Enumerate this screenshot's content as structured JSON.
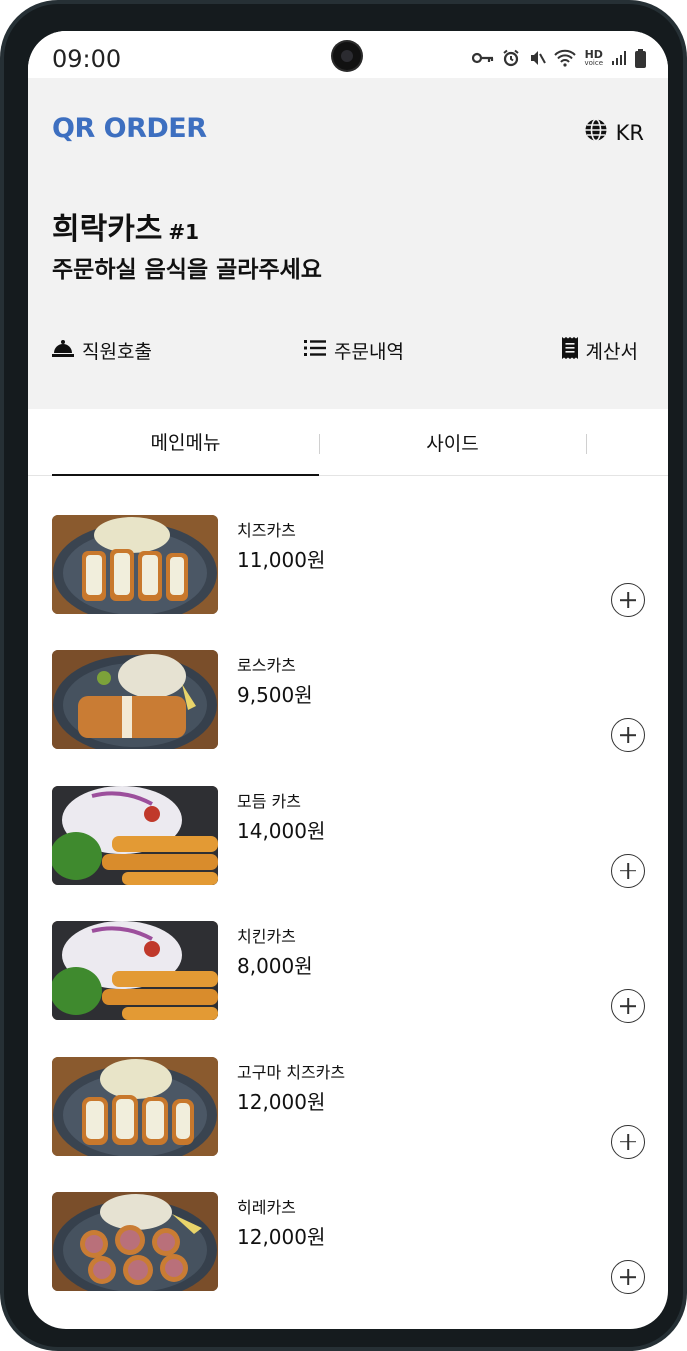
{
  "status_bar": {
    "time": "09:00",
    "icons": [
      "vpn-key-icon",
      "alarm-icon",
      "mute-icon",
      "wifi-icon",
      "hd-voice-icon",
      "signal-icon",
      "battery-icon"
    ],
    "hd_label": "HD",
    "voice_label": "voice"
  },
  "header": {
    "logo": "QR ORDER",
    "language": "KR",
    "restaurant_name": "희락카츠",
    "table_number": "#1",
    "subtitle": "주문하실 음식을 골라주세요",
    "brand_color": "#3d6fc0",
    "background_color": "#f2f2f2"
  },
  "actions": {
    "call_staff": "직원호출",
    "order_history": "주문내역",
    "bill": "계산서"
  },
  "tabs": [
    {
      "label": "메인메뉴",
      "active": true
    },
    {
      "label": "사이드",
      "active": false
    }
  ],
  "menu_items": [
    {
      "name": "치즈카츠",
      "price": "11,000원",
      "image": "cheese-katsu"
    },
    {
      "name": "로스카츠",
      "price": "9,500원",
      "image": "rosu-katsu"
    },
    {
      "name": "모듬 카츠",
      "price": "14,000원",
      "image": "assorted-katsu"
    },
    {
      "name": "치킨카츠",
      "price": "8,000원",
      "image": "chicken-katsu"
    },
    {
      "name": "고구마 치즈카츠",
      "price": "12,000원",
      "image": "sweet-potato-cheese-katsu"
    },
    {
      "name": "히레카츠",
      "price": "12,000원",
      "image": "hire-katsu"
    }
  ]
}
